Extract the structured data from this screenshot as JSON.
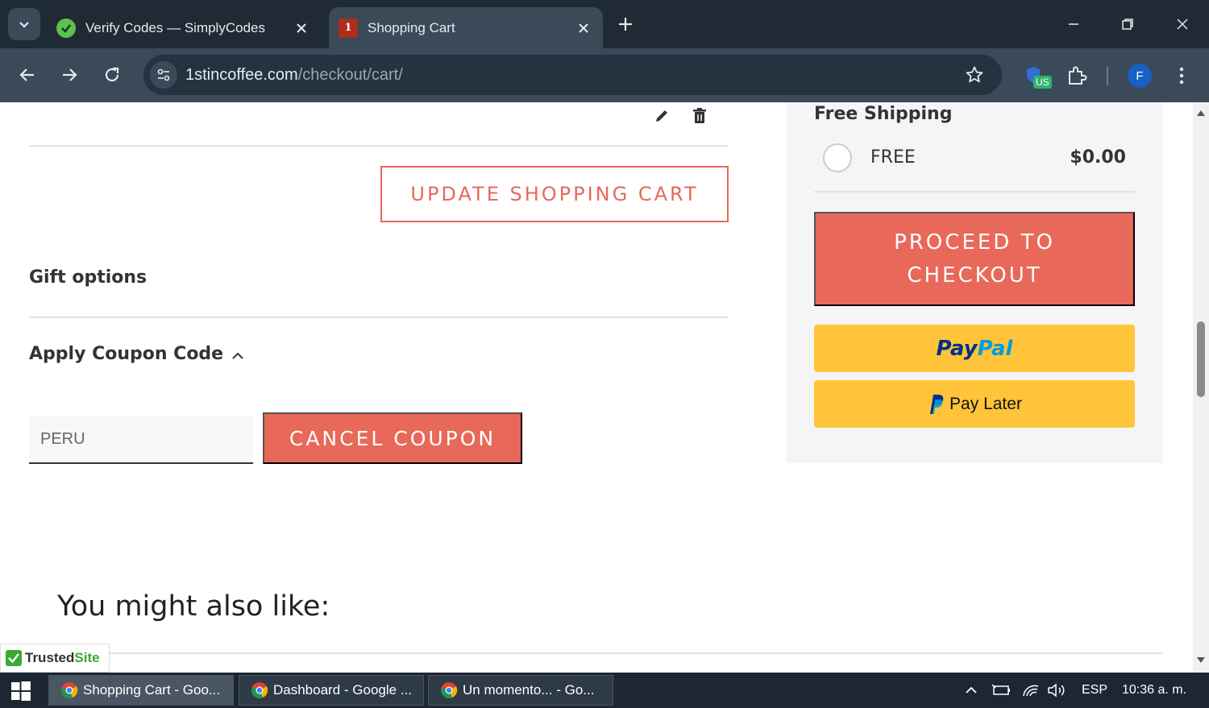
{
  "browser": {
    "tabs": [
      {
        "title": "Verify Codes — SimplyCodes",
        "active": false
      },
      {
        "title": "Shopping Cart",
        "active": true
      }
    ],
    "url_domain": "1stincoffee.com",
    "url_path": "/checkout/cart/",
    "extension_badge": "US",
    "profile_initial": "F"
  },
  "cart": {
    "update_button": "UPDATE SHOPPING CART",
    "gift_options": "Gift options",
    "coupon_heading": "Apply Coupon Code",
    "coupon_value": "PERU",
    "cancel_coupon_button": "CANCEL COUPON",
    "recommend_heading": "You might also like:"
  },
  "summary": {
    "shipping_title": "Free Shipping",
    "shipping_option_label": "FREE",
    "shipping_option_price": "$0.00",
    "checkout_line1": "PROCEED TO",
    "checkout_line2": "CHECKOUT",
    "paypal_pay": "Pay",
    "paypal_pal": "Pal",
    "paylater_label": "Pay Later"
  },
  "trusted_site": {
    "trusted": "Trusted",
    "site": "Site"
  },
  "taskbar": {
    "items": [
      {
        "label": "Shopping Cart - Goo...",
        "active": true
      },
      {
        "label": "Dashboard - Google ...",
        "active": false
      },
      {
        "label": "Un momento... - Go...",
        "active": false
      }
    ],
    "language": "ESP",
    "clock": "10:36 a. m."
  },
  "colors": {
    "accent": "#e8685a",
    "paypal_yellow": "#ffc439",
    "paypal_dark_blue": "#003087",
    "paypal_light_blue": "#009cde",
    "chrome_dark": "#1f2a35",
    "chrome_toolbar": "#3a4a58"
  }
}
